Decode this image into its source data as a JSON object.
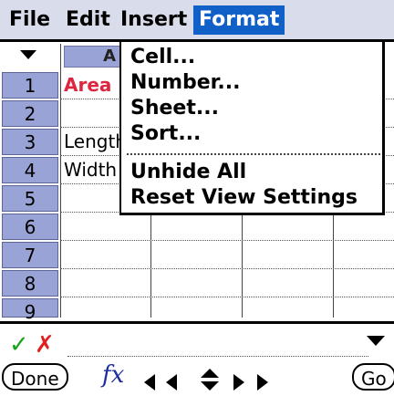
{
  "menubar": {
    "items": [
      {
        "label": "File"
      },
      {
        "label": "Edit"
      },
      {
        "label": "Insert"
      },
      {
        "label": "Format"
      }
    ],
    "active": "Format"
  },
  "grid": {
    "column_header": "A",
    "rows": [
      {
        "num": "1",
        "text": "Area"
      },
      {
        "num": "2",
        "text": ""
      },
      {
        "num": "3",
        "text": "Length"
      },
      {
        "num": "4",
        "text": "Width"
      },
      {
        "num": "5",
        "text": ""
      },
      {
        "num": "6",
        "text": ""
      },
      {
        "num": "7",
        "text": ""
      },
      {
        "num": "8",
        "text": ""
      },
      {
        "num": "9",
        "text": ""
      }
    ]
  },
  "format_menu": {
    "items": [
      "Cell...",
      "Number...",
      "Sheet...",
      "Sort...",
      "Unhide All",
      "Reset View Settings"
    ]
  },
  "toolbar": {
    "done_label": "Done",
    "fx_label": "fx",
    "go_label": "Go"
  },
  "colors": {
    "accent": "#1060c8",
    "header_bg": "#9aa3d6",
    "menubar_bg": "#d9dcea",
    "cell_red": "#e0263f",
    "check_green": "#17a317",
    "cross_red": "#e02020",
    "fx_blue": "#1a2d9c"
  }
}
